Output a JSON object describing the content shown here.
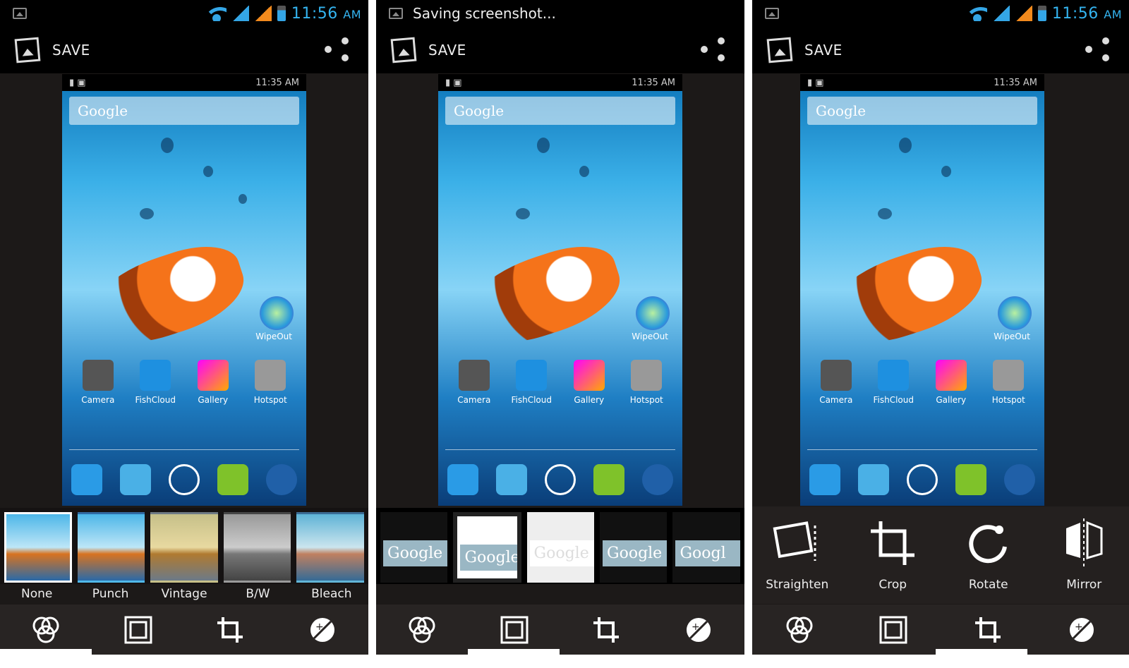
{
  "panels": [
    {
      "statusbar": {
        "time": "11:56",
        "ampm": "AM",
        "notification": ""
      },
      "actionbar": {
        "save_label": "SAVE"
      },
      "preview": {
        "time": "11:35 AM",
        "search_brand": "Google",
        "apps": [
          "Camera",
          "FishCloud",
          "Gallery",
          "Hotspot"
        ],
        "widget_label": "WipeOut"
      },
      "filters": [
        {
          "label": "None",
          "selected": true
        },
        {
          "label": "Punch",
          "selected": false
        },
        {
          "label": "Vintage",
          "selected": false
        },
        {
          "label": "B/W",
          "selected": false
        },
        {
          "label": "Bleach",
          "selected": false
        }
      ],
      "active_tab": 0
    },
    {
      "statusbar": {
        "notification": "Saving screenshot..."
      },
      "actionbar": {
        "save_label": "SAVE"
      },
      "preview": {
        "time": "11:35 AM",
        "search_brand": "Google",
        "apps": [
          "Camera",
          "FishCloud",
          "Gallery",
          "Hotspot"
        ],
        "widget_label": "WipeOut"
      },
      "frames": [
        "Google",
        "Google",
        "Google",
        "Google",
        "Googl"
      ],
      "active_tab": 1
    },
    {
      "statusbar": {
        "time": "11:56",
        "ampm": "AM"
      },
      "actionbar": {
        "save_label": "SAVE"
      },
      "preview": {
        "time": "11:35 AM",
        "search_brand": "Google",
        "apps": [
          "Camera",
          "FishCloud",
          "Gallery",
          "Hotspot"
        ],
        "widget_label": "WipeOut"
      },
      "tools": [
        "Straighten",
        "Crop",
        "Rotate",
        "Mirror"
      ],
      "active_tab": 2
    }
  ],
  "colors": {
    "accent": "#34b4f0",
    "signal_orange": "#f28a1d",
    "panel_bg": "#1c1918"
  }
}
